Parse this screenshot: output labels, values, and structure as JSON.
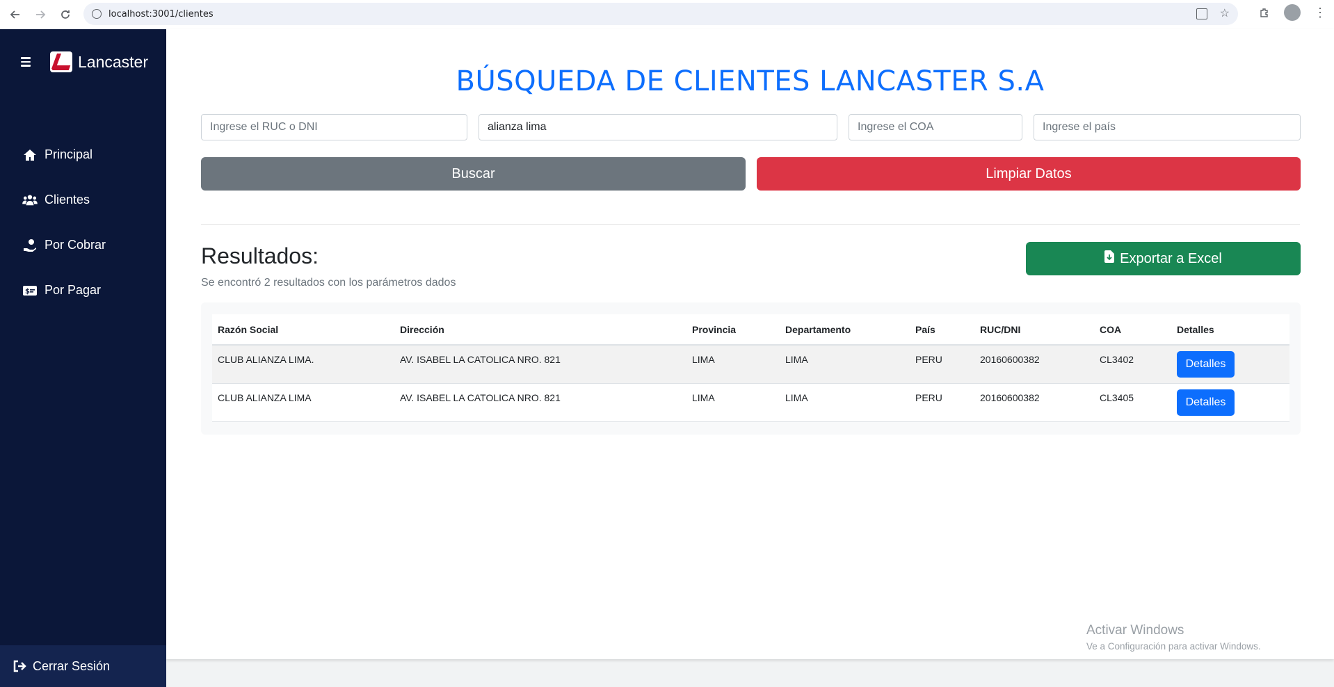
{
  "browser": {
    "url": "localhost:3001/clientes"
  },
  "sidebar": {
    "brand": "Lancaster",
    "items": [
      {
        "label": "Principal",
        "icon": "home-icon"
      },
      {
        "label": "Clientes",
        "icon": "users-icon"
      },
      {
        "label": "Por Cobrar",
        "icon": "hand-coin-icon"
      },
      {
        "label": "Por Pagar",
        "icon": "money-bill-icon"
      }
    ],
    "logout": "Cerrar Sesión"
  },
  "main": {
    "title": "BÚSQUEDA DE CLIENTES LANCASTER S.A",
    "filters": {
      "ruc": {
        "placeholder": "Ingrese el RUC o DNI",
        "value": ""
      },
      "name": {
        "placeholder": "",
        "value": "alianza lima"
      },
      "coa": {
        "placeholder": "Ingrese el COA",
        "value": ""
      },
      "country": {
        "placeholder": "Ingrese el país",
        "value": ""
      }
    },
    "search_label": "Buscar",
    "clear_label": "Limpiar Datos",
    "results_title": "Resultados:",
    "results_subtitle": "Se encontró 2 resultados con los parámetros dados",
    "export_label": "Exportar a Excel",
    "table": {
      "headers": [
        "Razón Social",
        "Dirección",
        "Provincia",
        "Departamento",
        "País",
        "RUC/DNI",
        "COA",
        "Detalles"
      ],
      "rows": [
        [
          "CLUB ALIANZA LIMA.",
          "AV. ISABEL LA CATOLICA NRO. 821",
          "LIMA",
          "LIMA",
          "PERU",
          "20160600382",
          "CL3402",
          "Detalles"
        ],
        [
          "CLUB ALIANZA LIMA",
          "AV. ISABEL LA CATOLICA NRO. 821",
          "LIMA",
          "LIMA",
          "PERU",
          "20160600382",
          "CL3405",
          "Detalles"
        ]
      ]
    }
  },
  "watermark": {
    "line1": "Activar Windows",
    "line2": "Ve a Configuración para activar Windows."
  },
  "colors": {
    "sidebar": "#0b1739",
    "primary": "#0d6efd",
    "danger": "#dc3545",
    "secondary": "#6c757d",
    "success": "#198754"
  }
}
